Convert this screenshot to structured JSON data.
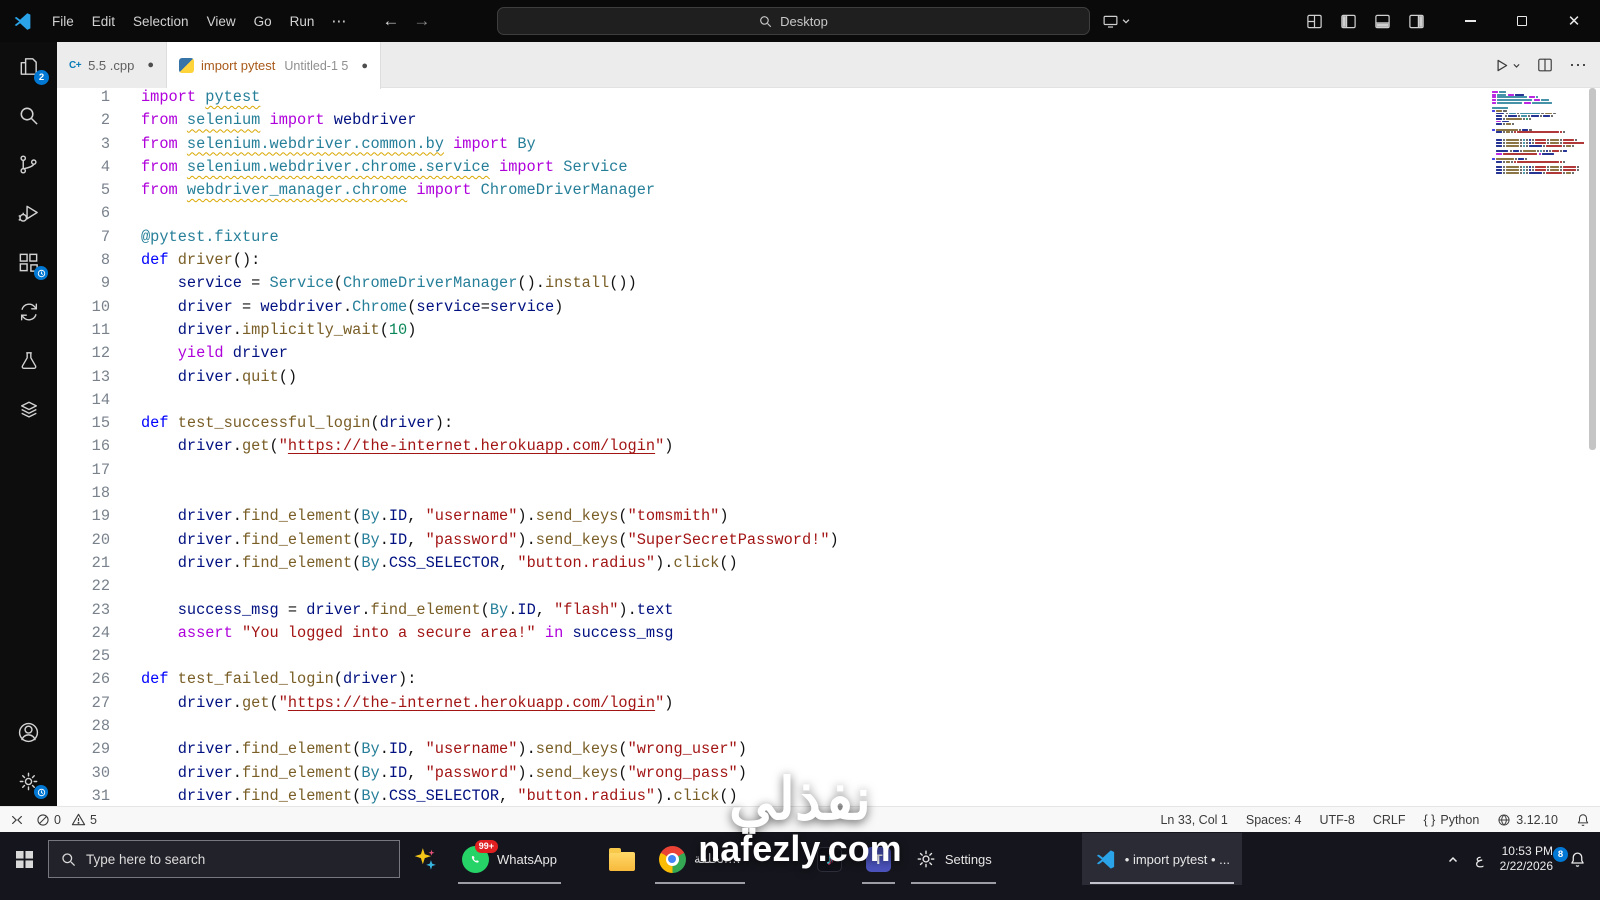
{
  "titlebar": {
    "menus": [
      "File",
      "Edit",
      "Selection",
      "View",
      "Go",
      "Run"
    ],
    "more_label": "⋯",
    "back_arrow": "←",
    "forward_arrow": "→",
    "search_label": "Desktop"
  },
  "tabs": [
    {
      "label": "5.5 .cpp",
      "desc": "",
      "icon": "cpp",
      "active": false,
      "dot": "●"
    },
    {
      "label": "import pytest",
      "desc": "Untitled-1 5",
      "icon": "python",
      "active": true,
      "dot": "●"
    }
  ],
  "badges": {
    "explorer": "2"
  },
  "editor": {
    "lines": [
      {
        "n": "1",
        "t": [
          [
            "k",
            "import "
          ],
          [
            "w",
            "pytest"
          ]
        ]
      },
      {
        "n": "2",
        "t": [
          [
            "k",
            "from "
          ],
          [
            "w",
            "selenium"
          ],
          [
            "k",
            " import "
          ],
          [
            "v",
            "webdriver"
          ]
        ]
      },
      {
        "n": "3",
        "t": [
          [
            "k",
            "from "
          ],
          [
            "w",
            "selenium.webdriver.common.by"
          ],
          [
            "k",
            " import "
          ],
          [
            "c",
            "By"
          ]
        ]
      },
      {
        "n": "4",
        "t": [
          [
            "k",
            "from "
          ],
          [
            "w",
            "selenium.webdriver.chrome.service"
          ],
          [
            "k",
            " import "
          ],
          [
            "c",
            "Service"
          ]
        ]
      },
      {
        "n": "5",
        "t": [
          [
            "k",
            "from "
          ],
          [
            "w",
            "webdriver_manager.chrome"
          ],
          [
            "k",
            " import "
          ],
          [
            "c",
            "ChromeDriverManager"
          ]
        ]
      },
      {
        "n": "6",
        "t": []
      },
      {
        "n": "7",
        "t": [
          [
            "c",
            "@pytest.fixture"
          ]
        ]
      },
      {
        "n": "8",
        "t": [
          [
            "d",
            "def "
          ],
          [
            "f",
            "driver"
          ],
          [
            "p",
            "():"
          ]
        ]
      },
      {
        "n": "9",
        "t": [
          [
            "p",
            "    "
          ],
          [
            "v",
            "service"
          ],
          [
            "p",
            " = "
          ],
          [
            "c",
            "Service"
          ],
          [
            "p",
            "("
          ],
          [
            "c",
            "ChromeDriverManager"
          ],
          [
            "p",
            "()."
          ],
          [
            "f",
            "install"
          ],
          [
            "p",
            "())"
          ]
        ]
      },
      {
        "n": "10",
        "t": [
          [
            "p",
            "    "
          ],
          [
            "v",
            "driver"
          ],
          [
            "p",
            " = "
          ],
          [
            "v",
            "webdriver"
          ],
          [
            "p",
            "."
          ],
          [
            "c",
            "Chrome"
          ],
          [
            "p",
            "("
          ],
          [
            "v",
            "service"
          ],
          [
            "p",
            "="
          ],
          [
            "v",
            "service"
          ],
          [
            "p",
            ")"
          ]
        ]
      },
      {
        "n": "11",
        "t": [
          [
            "p",
            "    "
          ],
          [
            "v",
            "driver"
          ],
          [
            "p",
            "."
          ],
          [
            "f",
            "implicitly_wait"
          ],
          [
            "p",
            "("
          ],
          [
            "m",
            "10"
          ],
          [
            "p",
            ")"
          ]
        ]
      },
      {
        "n": "12",
        "t": [
          [
            "p",
            "    "
          ],
          [
            "k",
            "yield "
          ],
          [
            "v",
            "driver"
          ]
        ]
      },
      {
        "n": "13",
        "t": [
          [
            "p",
            "    "
          ],
          [
            "v",
            "driver"
          ],
          [
            "p",
            "."
          ],
          [
            "f",
            "quit"
          ],
          [
            "p",
            "()"
          ]
        ]
      },
      {
        "n": "14",
        "t": []
      },
      {
        "n": "15",
        "t": [
          [
            "d",
            "def "
          ],
          [
            "f",
            "test_successful_login"
          ],
          [
            "p",
            "("
          ],
          [
            "v",
            "driver"
          ],
          [
            "p",
            "):"
          ]
        ]
      },
      {
        "n": "16",
        "t": [
          [
            "p",
            "    "
          ],
          [
            "v",
            "driver"
          ],
          [
            "p",
            "."
          ],
          [
            "f",
            "get"
          ],
          [
            "p",
            "("
          ],
          [
            "s",
            "\""
          ],
          [
            "u",
            "https://the-internet.herokuapp.com/login"
          ],
          [
            "s",
            "\""
          ],
          [
            "p",
            ")"
          ]
        ]
      },
      {
        "n": "17",
        "t": []
      },
      {
        "n": "18",
        "t": []
      },
      {
        "n": "19",
        "t": [
          [
            "p",
            "    "
          ],
          [
            "v",
            "driver"
          ],
          [
            "p",
            "."
          ],
          [
            "f",
            "find_element"
          ],
          [
            "p",
            "("
          ],
          [
            "c",
            "By"
          ],
          [
            "p",
            "."
          ],
          [
            "v",
            "ID"
          ],
          [
            "p",
            ", "
          ],
          [
            "s",
            "\"username\""
          ],
          [
            "p",
            ")."
          ],
          [
            "f",
            "send_keys"
          ],
          [
            "p",
            "("
          ],
          [
            "s",
            "\"tomsmith\""
          ],
          [
            "p",
            ")"
          ]
        ]
      },
      {
        "n": "20",
        "t": [
          [
            "p",
            "    "
          ],
          [
            "v",
            "driver"
          ],
          [
            "p",
            "."
          ],
          [
            "f",
            "find_element"
          ],
          [
            "p",
            "("
          ],
          [
            "c",
            "By"
          ],
          [
            "p",
            "."
          ],
          [
            "v",
            "ID"
          ],
          [
            "p",
            ", "
          ],
          [
            "s",
            "\"password\""
          ],
          [
            "p",
            ")."
          ],
          [
            "f",
            "send_keys"
          ],
          [
            "p",
            "("
          ],
          [
            "s",
            "\"SuperSecretPassword!\""
          ],
          [
            "p",
            ")"
          ]
        ]
      },
      {
        "n": "21",
        "t": [
          [
            "p",
            "    "
          ],
          [
            "v",
            "driver"
          ],
          [
            "p",
            "."
          ],
          [
            "f",
            "find_element"
          ],
          [
            "p",
            "("
          ],
          [
            "c",
            "By"
          ],
          [
            "p",
            "."
          ],
          [
            "v",
            "CSS_SELECTOR"
          ],
          [
            "p",
            ", "
          ],
          [
            "s",
            "\"button.radius\""
          ],
          [
            "p",
            ")."
          ],
          [
            "f",
            "click"
          ],
          [
            "p",
            "()"
          ]
        ]
      },
      {
        "n": "22",
        "t": []
      },
      {
        "n": "23",
        "t": [
          [
            "p",
            "    "
          ],
          [
            "v",
            "success_msg"
          ],
          [
            "p",
            " = "
          ],
          [
            "v",
            "driver"
          ],
          [
            "p",
            "."
          ],
          [
            "f",
            "find_element"
          ],
          [
            "p",
            "("
          ],
          [
            "c",
            "By"
          ],
          [
            "p",
            "."
          ],
          [
            "v",
            "ID"
          ],
          [
            "p",
            ", "
          ],
          [
            "s",
            "\"flash\""
          ],
          [
            "p",
            ")."
          ],
          [
            "v",
            "text"
          ]
        ]
      },
      {
        "n": "24",
        "t": [
          [
            "p",
            "    "
          ],
          [
            "k",
            "assert "
          ],
          [
            "s",
            "\"You logged into a secure area!\""
          ],
          [
            "k",
            " in "
          ],
          [
            "v",
            "success_msg"
          ]
        ]
      },
      {
        "n": "25",
        "t": []
      },
      {
        "n": "26",
        "t": [
          [
            "d",
            "def "
          ],
          [
            "f",
            "test_failed_login"
          ],
          [
            "p",
            "("
          ],
          [
            "v",
            "driver"
          ],
          [
            "p",
            "):"
          ]
        ]
      },
      {
        "n": "27",
        "t": [
          [
            "p",
            "    "
          ],
          [
            "v",
            "driver"
          ],
          [
            "p",
            "."
          ],
          [
            "f",
            "get"
          ],
          [
            "p",
            "("
          ],
          [
            "s",
            "\""
          ],
          [
            "u",
            "https://the-internet.herokuapp.com/login"
          ],
          [
            "s",
            "\""
          ],
          [
            "p",
            ")"
          ]
        ]
      },
      {
        "n": "28",
        "t": []
      },
      {
        "n": "29",
        "t": [
          [
            "p",
            "    "
          ],
          [
            "v",
            "driver"
          ],
          [
            "p",
            "."
          ],
          [
            "f",
            "find_element"
          ],
          [
            "p",
            "("
          ],
          [
            "c",
            "By"
          ],
          [
            "p",
            "."
          ],
          [
            "v",
            "ID"
          ],
          [
            "p",
            ", "
          ],
          [
            "s",
            "\"username\""
          ],
          [
            "p",
            ")."
          ],
          [
            "f",
            "send_keys"
          ],
          [
            "p",
            "("
          ],
          [
            "s",
            "\"wrong_user\""
          ],
          [
            "p",
            ")"
          ]
        ]
      },
      {
        "n": "30",
        "t": [
          [
            "p",
            "    "
          ],
          [
            "v",
            "driver"
          ],
          [
            "p",
            "."
          ],
          [
            "f",
            "find_element"
          ],
          [
            "p",
            "("
          ],
          [
            "c",
            "By"
          ],
          [
            "p",
            "."
          ],
          [
            "v",
            "ID"
          ],
          [
            "p",
            ", "
          ],
          [
            "s",
            "\"password\""
          ],
          [
            "p",
            ")."
          ],
          [
            "f",
            "send_keys"
          ],
          [
            "p",
            "("
          ],
          [
            "s",
            "\"wrong_pass\""
          ],
          [
            "p",
            ")"
          ]
        ]
      },
      {
        "n": "31",
        "t": [
          [
            "p",
            "    "
          ],
          [
            "v",
            "driver"
          ],
          [
            "p",
            "."
          ],
          [
            "f",
            "find_element"
          ],
          [
            "p",
            "("
          ],
          [
            "c",
            "By"
          ],
          [
            "p",
            "."
          ],
          [
            "v",
            "CSS_SELECTOR"
          ],
          [
            "p",
            ", "
          ],
          [
            "s",
            "\"button.radius\""
          ],
          [
            "p",
            ")."
          ],
          [
            "f",
            "click"
          ],
          [
            "p",
            "()"
          ]
        ]
      }
    ]
  },
  "statusbar": {
    "errors": "0",
    "warnings": "5",
    "line_col": "Ln 33, Col 1",
    "spaces": "Spaces: 4",
    "encoding": "UTF-8",
    "eol": "CRLF",
    "language_icon": "{ }",
    "language": "Python",
    "version": "3.12.10"
  },
  "taskbar": {
    "search_placeholder": "Type here to search",
    "whatsapp_label": "WhatsApp",
    "whatsapp_badge": "99+",
    "chrome_label": "الحلقة…",
    "settings_label": "Settings",
    "vscode_label": "• import pytest • ...",
    "tray": {
      "lang": "ع",
      "time": "10:53 PM",
      "date": "2/22/2026",
      "notif_badge": "8"
    }
  },
  "watermark": {
    "title": "نفذلي",
    "subtitle": "nafezly.com"
  }
}
